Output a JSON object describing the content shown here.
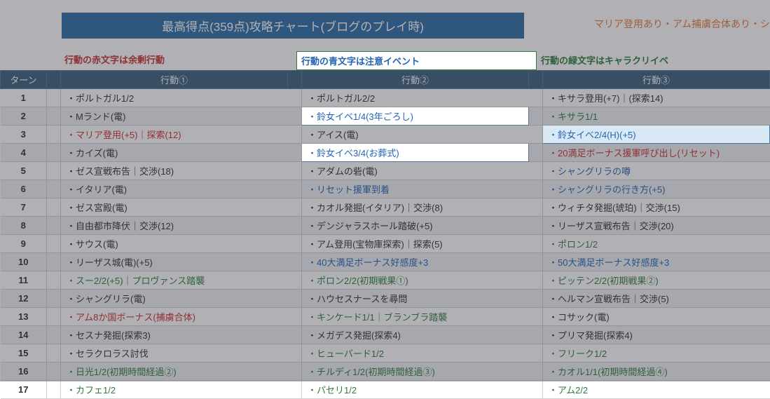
{
  "title": "最高得点(359点)攻略チャート(ブログのプレイ時)",
  "rightNote": "マリア登用あり・アム捕虜合体あり・シ",
  "legend": {
    "red": "行動の赤文字は余剰行動",
    "blue": "行動の青文字は注意イベント",
    "green": "行動の緑文字はキャラクリイベ"
  },
  "headers": {
    "turn": "ターン",
    "act1": "行動①",
    "act2": "行動②",
    "act3": "行動③"
  },
  "rows": [
    {
      "turn": "1",
      "a1": {
        "t": "・ポルトガル1/2",
        "c": "black"
      },
      "a2": {
        "t": "・ポルトガル2/2",
        "c": "black"
      },
      "a3": {
        "t": "・キサラ登用(+7)｜(探索14)",
        "c": "black"
      }
    },
    {
      "turn": "2",
      "a1": {
        "t": "・Mランド(電)",
        "c": "black"
      },
      "a2": {
        "t": "・鈴女イベ1/4(3年ごろし)",
        "c": "blue",
        "hl": "hl"
      },
      "a3": {
        "t": "・キサラ1/1",
        "c": "green"
      }
    },
    {
      "turn": "3",
      "a1": {
        "t": "・マリア登用(+5)｜探索(12)",
        "c": "red"
      },
      "a2": {
        "t": "・アイス(電)",
        "c": "black"
      },
      "a3": {
        "t": "・鈴女イベ2/4(H)(+5)",
        "c": "blue",
        "hl": "hl-sel"
      }
    },
    {
      "turn": "4",
      "a1": {
        "t": "・カイズ(電)",
        "c": "black"
      },
      "a2": {
        "t": "・鈴女イベ3/4(お葬式)",
        "c": "blue",
        "hl": "hl"
      },
      "a3": {
        "t": "・20満足ボーナス援軍呼び出し(リセット)",
        "c": "red"
      }
    },
    {
      "turn": "5",
      "a1": {
        "t": "・ゼス宣戦布告｜交渉(18)",
        "c": "black"
      },
      "a2": {
        "t": "・アダムの砦(電)",
        "c": "black"
      },
      "a3": {
        "t": "・シャングリラの噂",
        "c": "blue"
      }
    },
    {
      "turn": "6",
      "a1": {
        "t": "・イタリア(電)",
        "c": "black"
      },
      "a2": {
        "t": "・リセット援軍到着",
        "c": "blue"
      },
      "a3": {
        "t": "・シャングリラの行き方(+5)",
        "c": "blue"
      }
    },
    {
      "turn": "7",
      "a1": {
        "t": "・ゼス宮殿(電)",
        "c": "black"
      },
      "a2": {
        "t": "・カオル発掘(イタリア)｜交渉(8)",
        "c": "black"
      },
      "a3": {
        "t": "・ウィチタ発掘(琥珀)｜交渉(15)",
        "c": "black"
      }
    },
    {
      "turn": "8",
      "a1": {
        "t": "・自由都市降伏｜交渉(12)",
        "c": "black"
      },
      "a2": {
        "t": "・デンジャラスホール踏破(+5)",
        "c": "black"
      },
      "a3": {
        "t": "・リーザス宣戦布告｜交渉(20)",
        "c": "black"
      }
    },
    {
      "turn": "9",
      "a1": {
        "t": "・サウス(電)",
        "c": "black"
      },
      "a2": {
        "t": "・アム登用(宝物庫探索)｜探索(5)",
        "c": "black"
      },
      "a3": {
        "t": "・ポロン1/2",
        "c": "green"
      }
    },
    {
      "turn": "10",
      "a1": {
        "t": "・リーザス城(電)(+5)",
        "c": "black"
      },
      "a2": {
        "t": "・40大満足ボーナス好感度+3",
        "c": "blue"
      },
      "a3": {
        "t": "・50大満足ボーナス好感度+3",
        "c": "blue"
      }
    },
    {
      "turn": "11",
      "a1": {
        "t": "・スー2/2(+5)｜プロヴァンス踏襲",
        "c": "green"
      },
      "a2": {
        "t": "・ポロン2/2(初期戦果①)",
        "c": "green"
      },
      "a3": {
        "t": "・ピッテン2/2(初期戦果②)",
        "c": "green"
      }
    },
    {
      "turn": "12",
      "a1": {
        "t": "・シャングリラ(電)",
        "c": "black"
      },
      "a2": {
        "t": "・ハウセスナースを尋問",
        "c": "black"
      },
      "a3": {
        "t": "・ヘルマン宣戦布告｜交渉(5)",
        "c": "black"
      }
    },
    {
      "turn": "13",
      "a1": {
        "t": "・アム8か国ボーナス(捕虜合体)",
        "c": "red"
      },
      "a2": {
        "t": "・キンケード1/1｜ブランブラ踏襲",
        "c": "green"
      },
      "a3": {
        "t": "・コサック(電)",
        "c": "black"
      }
    },
    {
      "turn": "14",
      "a1": {
        "t": "・セスナ発掘(探索3)",
        "c": "black"
      },
      "a2": {
        "t": "・メガデス発掘(探索4)",
        "c": "black"
      },
      "a3": {
        "t": "・プリマ発掘(探索4)",
        "c": "black"
      }
    },
    {
      "turn": "15",
      "a1": {
        "t": "・セラクロラス討伐",
        "c": "black"
      },
      "a2": {
        "t": "・ヒューバード1/2",
        "c": "green"
      },
      "a3": {
        "t": "・フリーク1/2",
        "c": "green"
      }
    },
    {
      "turn": "16",
      "a1": {
        "t": "・日光1/2(初期時間経過②)",
        "c": "green"
      },
      "a2": {
        "t": "・チルディ1/2(初期時間経過③)",
        "c": "green"
      },
      "a3": {
        "t": "・カオル1/1(初期時間経過④)",
        "c": "green"
      }
    },
    {
      "turn": "17",
      "a1": {
        "t": "・カフェ1/2",
        "c": "green"
      },
      "a2": {
        "t": "・パセリ1/2",
        "c": "green"
      },
      "a3": {
        "t": "・アム2/2",
        "c": "green"
      }
    }
  ]
}
